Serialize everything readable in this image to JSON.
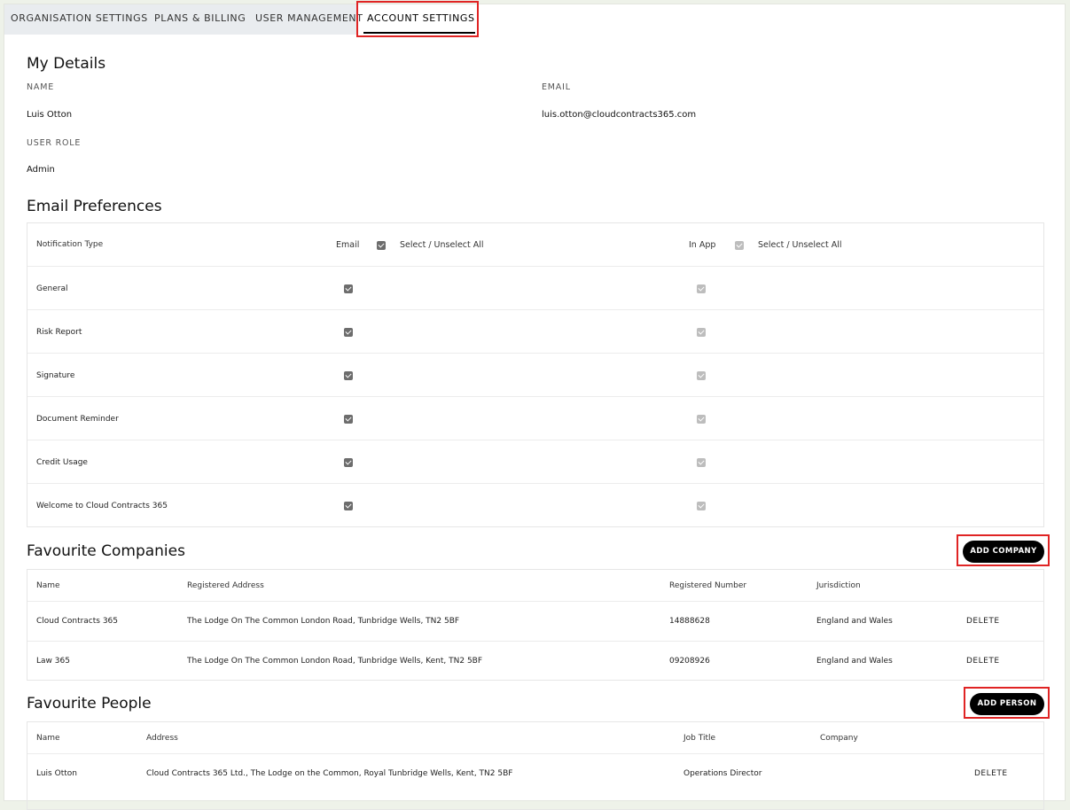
{
  "tabs": [
    {
      "label": "ORGANISATION SETTINGS"
    },
    {
      "label": "PLANS & BILLING"
    },
    {
      "label": "USER MANAGEMENT"
    },
    {
      "label": "ACCOUNT SETTINGS",
      "active": true
    }
  ],
  "my_details": {
    "title": "My Details",
    "name_label": "NAME",
    "name_value": "Luis Otton",
    "email_label": "EMAIL",
    "email_value": "luis.otton@cloudcontracts365.com",
    "role_label": "USER ROLE",
    "role_value": "Admin"
  },
  "email_prefs": {
    "title": "Email Preferences",
    "header": {
      "type": "Notification Type",
      "email": "Email",
      "email_select_all": "Select / Unselect All",
      "inapp": "In App",
      "inapp_select_all": "Select / Unselect All"
    },
    "rows": [
      {
        "label": "General",
        "email": true,
        "inapp": true
      },
      {
        "label": "Risk Report",
        "email": true,
        "inapp": true
      },
      {
        "label": "Signature",
        "email": true,
        "inapp": true
      },
      {
        "label": "Document Reminder",
        "email": true,
        "inapp": true
      },
      {
        "label": "Credit Usage",
        "email": true,
        "inapp": true
      },
      {
        "label": "Welcome to Cloud Contracts 365",
        "email": true,
        "inapp": true
      }
    ]
  },
  "companies": {
    "title": "Favourite Companies",
    "add_label": "ADD COMPANY",
    "columns": [
      "Name",
      "Registered Address",
      "Registered Number",
      "Jurisdiction"
    ],
    "rows": [
      {
        "name": "Cloud Contracts 365",
        "address": "The Lodge On The Common London Road, Tunbridge Wells, TN2 5BF",
        "number": "14888628",
        "jurisdiction": "England and Wales",
        "action": "DELETE"
      },
      {
        "name": "Law 365",
        "address": "The Lodge On The Common London Road, Tunbridge Wells, Kent, TN2 5BF",
        "number": "09208926",
        "jurisdiction": "England and Wales",
        "action": "DELETE"
      }
    ]
  },
  "people": {
    "title": "Favourite People",
    "add_label": "ADD PERSON",
    "columns": [
      "Name",
      "Address",
      "Job Title",
      "Company"
    ],
    "rows": [
      {
        "name": "Luis Otton",
        "address": "Cloud Contracts 365 Ltd., The Lodge on the Common, Royal Tunbridge Wells, Kent, TN2 5BF",
        "job": "Operations Director",
        "company": "",
        "action": "DELETE"
      }
    ]
  }
}
